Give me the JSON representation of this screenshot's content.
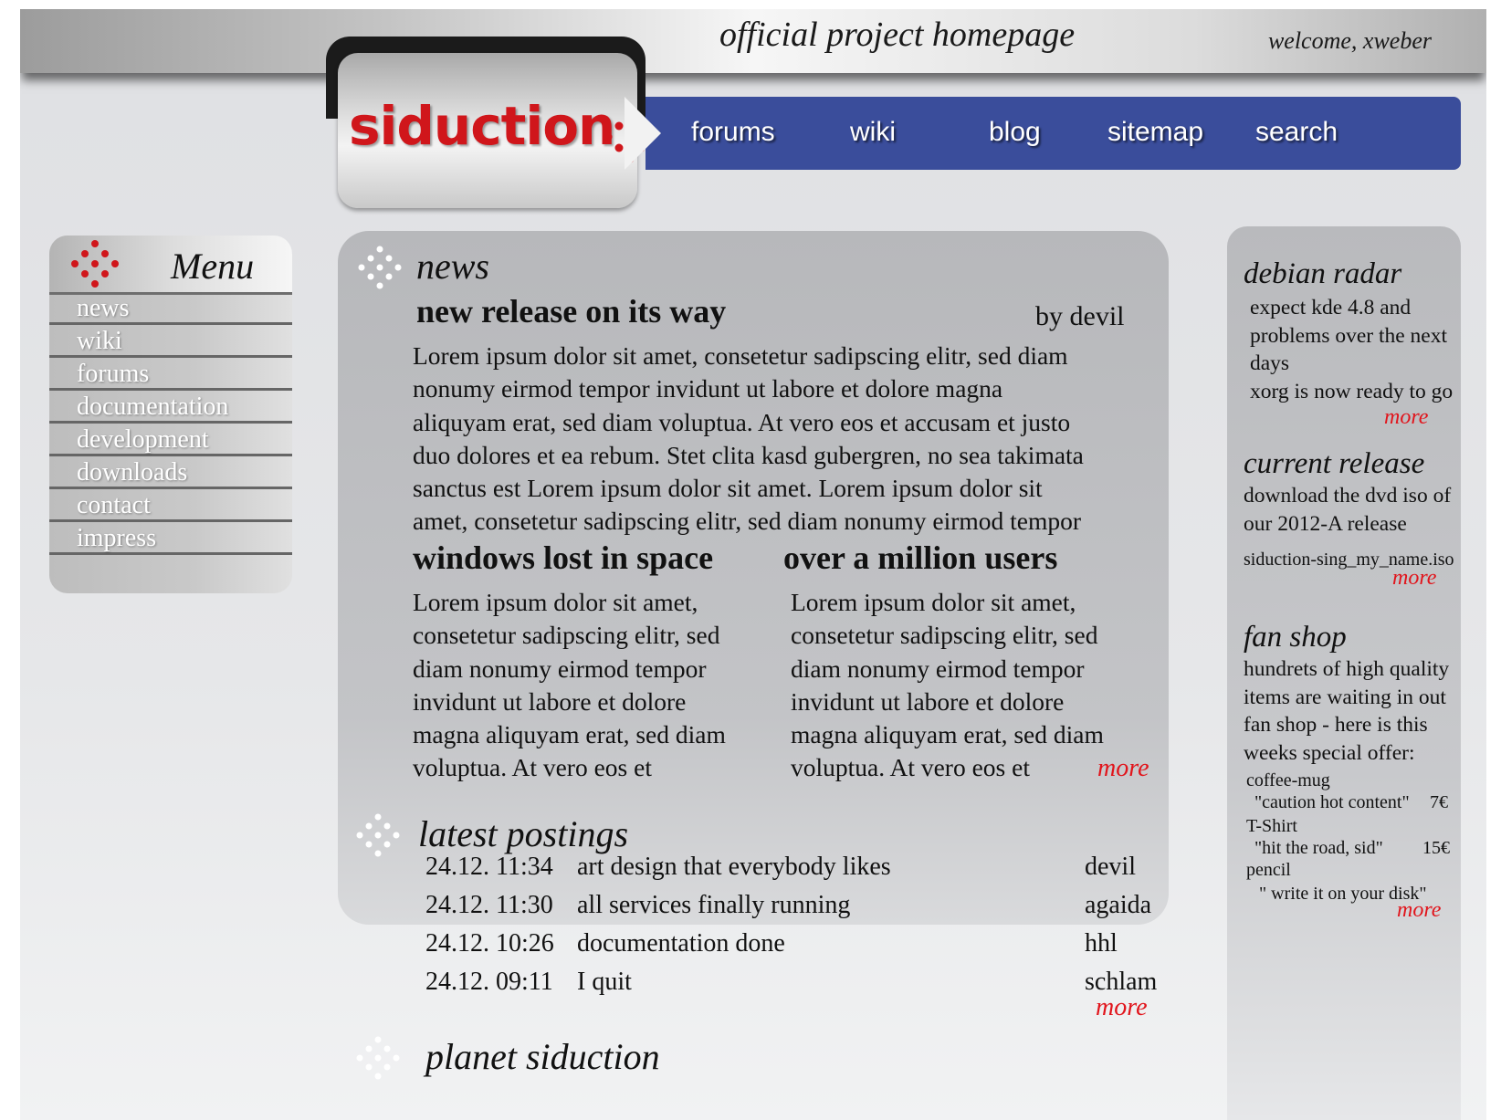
{
  "header": {
    "tagline": "official project homepage",
    "welcome": "welcome, xweber",
    "logo_text": "siduction",
    "logo_color": "#d0161b"
  },
  "nav": {
    "color": "#3a4d9b",
    "items": [
      {
        "label": "forums"
      },
      {
        "label": "wiki"
      },
      {
        "label": "blog"
      },
      {
        "label": "sitemap"
      },
      {
        "label": "search"
      }
    ]
  },
  "menu": {
    "title": "Menu",
    "items": [
      {
        "label": "news"
      },
      {
        "label": "wiki"
      },
      {
        "label": "forums"
      },
      {
        "label": "documentation"
      },
      {
        "label": "development"
      },
      {
        "label": "downloads"
      },
      {
        "label": "contact"
      },
      {
        "label": "impress"
      }
    ]
  },
  "news": {
    "section_title": "news",
    "lead": {
      "title": "new release on its way",
      "byline": "by devil",
      "lines": [
        "Lorem ipsum dolor sit amet, consetetur sadipscing elitr, sed diam",
        "nonumy eirmod tempor invidunt ut labore et dolore magna",
        "aliquyam erat, sed diam voluptua. At vero eos et accusam et justo",
        "duo dolores et ea rebum. Stet clita kasd gubergren, no sea takimata",
        "sanctus est Lorem ipsum dolor sit amet. Lorem ipsum dolor sit",
        "amet, consetetur sadipscing elitr, sed diam nonumy eirmod tempor"
      ]
    },
    "columns": [
      {
        "title": "windows lost in space",
        "lines": [
          "Lorem ipsum dolor sit amet,",
          "consetetur sadipscing elitr, sed",
          "diam nonumy eirmod tempor",
          "invidunt ut labore et dolore",
          "magna aliquyam erat, sed diam",
          "voluptua. At vero eos et"
        ]
      },
      {
        "title": "over a million users",
        "lines": [
          "Lorem ipsum dolor sit amet,",
          "consetetur sadipscing elitr, sed",
          "diam nonumy eirmod tempor",
          "invidunt ut labore et dolore",
          "magna aliquyam erat, sed diam",
          "voluptua. At vero eos et"
        ]
      }
    ],
    "more_label": "more"
  },
  "postings": {
    "section_title": "latest postings",
    "rows": [
      {
        "date": "24.12. 11:34",
        "title": "art design that everybody likes",
        "author": "devil"
      },
      {
        "date": "24.12. 11:30",
        "title": "all services finally running",
        "author": "agaida"
      },
      {
        "date": "24.12. 10:26",
        "title": "documentation done",
        "author": "hhl"
      },
      {
        "date": "24.12. 09:11",
        "title": "I quit",
        "author": "schlam"
      }
    ],
    "more_label": "more"
  },
  "planet": {
    "section_title": "planet siduction"
  },
  "sidebar": {
    "radar": {
      "title": "debian radar",
      "lines": [
        "expect kde 4.8 and",
        "problems over the next",
        "days",
        "xorg is now ready to go"
      ],
      "more_label": "more"
    },
    "release": {
      "title": "current release",
      "lines": [
        "download the dvd iso of",
        "our 2012-A release"
      ],
      "file": "siduction-sing_my_name.iso",
      "more_label": "more"
    },
    "shop": {
      "title": "fan shop",
      "lines": [
        "hundrets of high quality",
        "items are waiting in out",
        "fan shop - here is this",
        "weeks special offer:"
      ],
      "items": [
        {
          "name": "coffee-mug",
          "slogan": "\"caution hot content\"",
          "price": "7€"
        },
        {
          "name": "T-Shirt",
          "slogan": "\"hit the road, sid\"",
          "price": "15€"
        },
        {
          "name": "pencil",
          "slogan": "\" write it on your disk\"",
          "price": ""
        }
      ],
      "more_label": "more"
    }
  },
  "colors": {
    "accent_red": "#e1141b",
    "nav_blue": "#3a4d9b"
  }
}
